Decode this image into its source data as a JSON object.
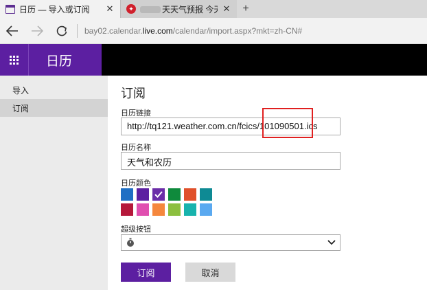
{
  "browser": {
    "tabs": [
      {
        "title": "日历 — 导入或订阅",
        "favicon": "calendar-icon",
        "active": true
      },
      {
        "title": "天天气预报 今天_周",
        "favicon": "weather-site-icon",
        "active": false
      }
    ],
    "close_glyph": "✕",
    "new_tab_glyph": "+",
    "url_prefix": "bay02.calendar.",
    "url_host": "live.com",
    "url_path": "/calendar/import.aspx?mkt=zh-CN#"
  },
  "app": {
    "title": "日历",
    "brand_color": "#5c1fa1"
  },
  "sidebar": {
    "items": [
      {
        "label": "导入",
        "selected": false
      },
      {
        "label": "订阅",
        "selected": true
      }
    ]
  },
  "form": {
    "heading": "订阅",
    "calendar_link_label": "日历链接",
    "calendar_link_value": "http://tq121.weather.com.cn/fcics/101090501.ics",
    "calendar_name_label": "日历名称",
    "calendar_name_value": "天气和农历",
    "calendar_color_label": "日历颜色",
    "colors": [
      "#1f6fc4",
      "#5c1fa1",
      "#6b2da8",
      "#0f8a3c",
      "#e0502a",
      "#0e8a94",
      "#b5183a",
      "#e04fb0",
      "#f5873d",
      "#8cbf3f",
      "#17b3ad",
      "#5aa9f0"
    ],
    "selected_color_index": 2,
    "charm_label": "超级按钮",
    "charm_icon": "stopwatch-icon",
    "subscribe_button": "订阅",
    "cancel_button": "取消"
  }
}
